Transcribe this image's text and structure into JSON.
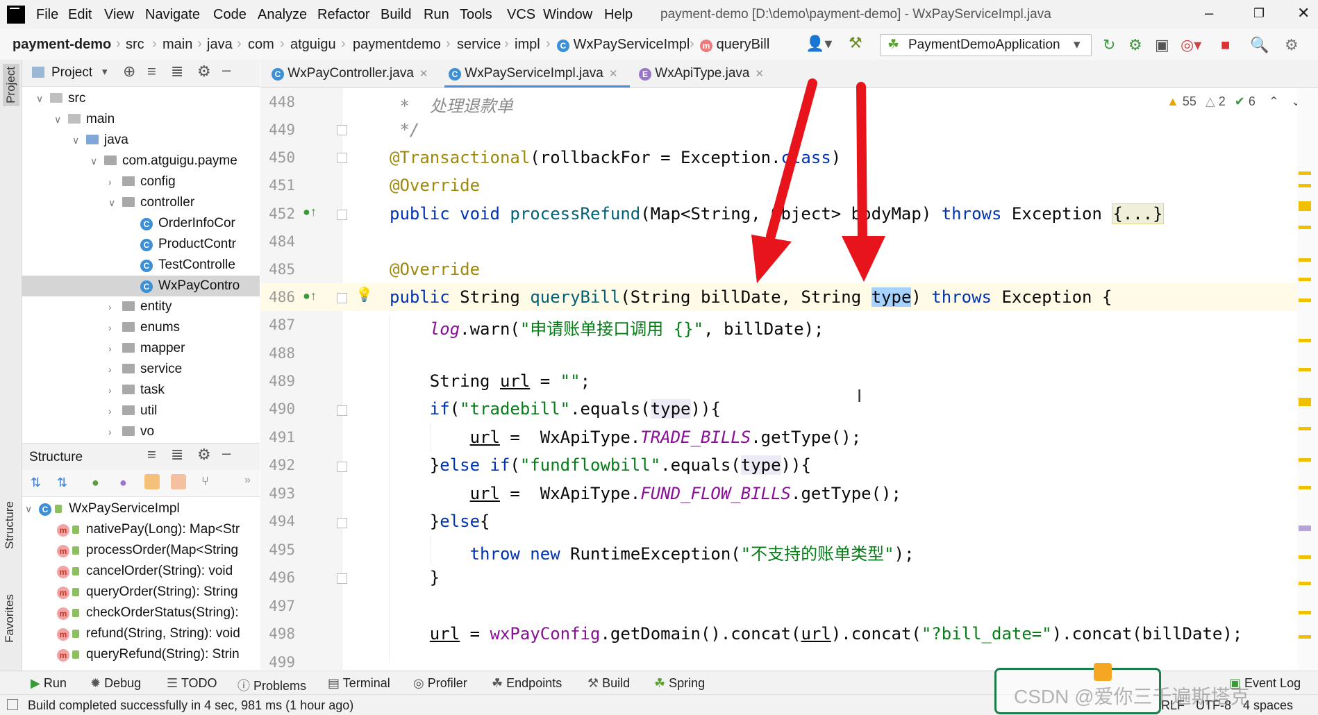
{
  "menubar": {
    "items": [
      "File",
      "Edit",
      "View",
      "Navigate",
      "Code",
      "Analyze",
      "Refactor",
      "Build",
      "Run",
      "Tools",
      "VCS",
      "Window",
      "Help"
    ],
    "title": "payment-demo [D:\\demo\\payment-demo] - WxPayServiceImpl.java"
  },
  "navbar": {
    "crumbs": [
      "payment-demo",
      "src",
      "main",
      "java",
      "com",
      "atguigu",
      "paymentdemo",
      "service",
      "impl",
      "WxPayServiceImpl",
      "queryBill"
    ],
    "run_config": "PaymentDemoApplication"
  },
  "project_panel": {
    "title": "Project",
    "tree": [
      {
        "label": "src",
        "level": 1,
        "expanded": true,
        "type": "folder"
      },
      {
        "label": "main",
        "level": 2,
        "expanded": true,
        "type": "folder"
      },
      {
        "label": "java",
        "level": 3,
        "expanded": true,
        "type": "folder-blue"
      },
      {
        "label": "com.atguigu.payme",
        "level": 4,
        "expanded": true,
        "type": "package"
      },
      {
        "label": "config",
        "level": 5,
        "expanded": false,
        "type": "package"
      },
      {
        "label": "controller",
        "level": 5,
        "expanded": true,
        "type": "package"
      },
      {
        "label": "OrderInfoCor",
        "level": 6,
        "type": "class"
      },
      {
        "label": "ProductContr",
        "level": 6,
        "type": "class"
      },
      {
        "label": "TestControlle",
        "level": 6,
        "type": "class"
      },
      {
        "label": "WxPayContro",
        "level": 6,
        "type": "class",
        "selected": true
      },
      {
        "label": "entity",
        "level": 5,
        "expanded": false,
        "type": "package"
      },
      {
        "label": "enums",
        "level": 5,
        "expanded": false,
        "type": "package"
      },
      {
        "label": "mapper",
        "level": 5,
        "expanded": false,
        "type": "package"
      },
      {
        "label": "service",
        "level": 5,
        "expanded": false,
        "type": "package"
      },
      {
        "label": "task",
        "level": 5,
        "expanded": false,
        "type": "package"
      },
      {
        "label": "util",
        "level": 5,
        "expanded": false,
        "type": "package"
      },
      {
        "label": "vo",
        "level": 5,
        "expanded": false,
        "type": "package"
      }
    ]
  },
  "structure_panel": {
    "title": "Structure",
    "root": "WxPayServiceImpl",
    "members": [
      "nativePay(Long): Map<Str",
      "processOrder(Map<String",
      "cancelOrder(String): void",
      "queryOrder(String): String",
      "checkOrderStatus(String):",
      "refund(String, String): void",
      "queryRefund(String): Strin"
    ]
  },
  "side_tabs": {
    "project": "Project",
    "structure": "Structure",
    "favorites": "Favorites"
  },
  "editor": {
    "tabs": [
      {
        "label": "WxPayController.java",
        "icon": "C",
        "active": false
      },
      {
        "label": "WxPayServiceImpl.java",
        "icon": "C",
        "active": true
      },
      {
        "label": "WxApiType.java",
        "icon": "E",
        "active": false
      }
    ],
    "inspections": {
      "warnings": "55",
      "weak_warnings": "2",
      "ok": "6"
    },
    "line_numbers": [
      "448",
      "449",
      "450",
      "451",
      "452",
      "484",
      "485",
      "486",
      "487",
      "488",
      "489",
      "490",
      "491",
      "492",
      "493",
      "494",
      "495",
      "496",
      "497",
      "498",
      "499"
    ]
  },
  "bottom_tools": [
    "Run",
    "Debug",
    "TODO",
    "Problems",
    "Terminal",
    "Profiler",
    "Endpoints",
    "Build",
    "Spring"
  ],
  "event_log": "Event Log",
  "status": {
    "message": "Build completed successfully in 4 sec, 981 ms (1 hour ago)",
    "line_sep": "RLF",
    "encoding": "UTF-8",
    "indent": "4 spaces"
  },
  "watermark": "CSDN @爱你三千遍斯塔克",
  "colors": {
    "keyword": "#0033b3",
    "annotation": "#9e880d",
    "method": "#00627a",
    "string": "#067d17",
    "static": "#871094",
    "arrow": "#e8141c"
  }
}
